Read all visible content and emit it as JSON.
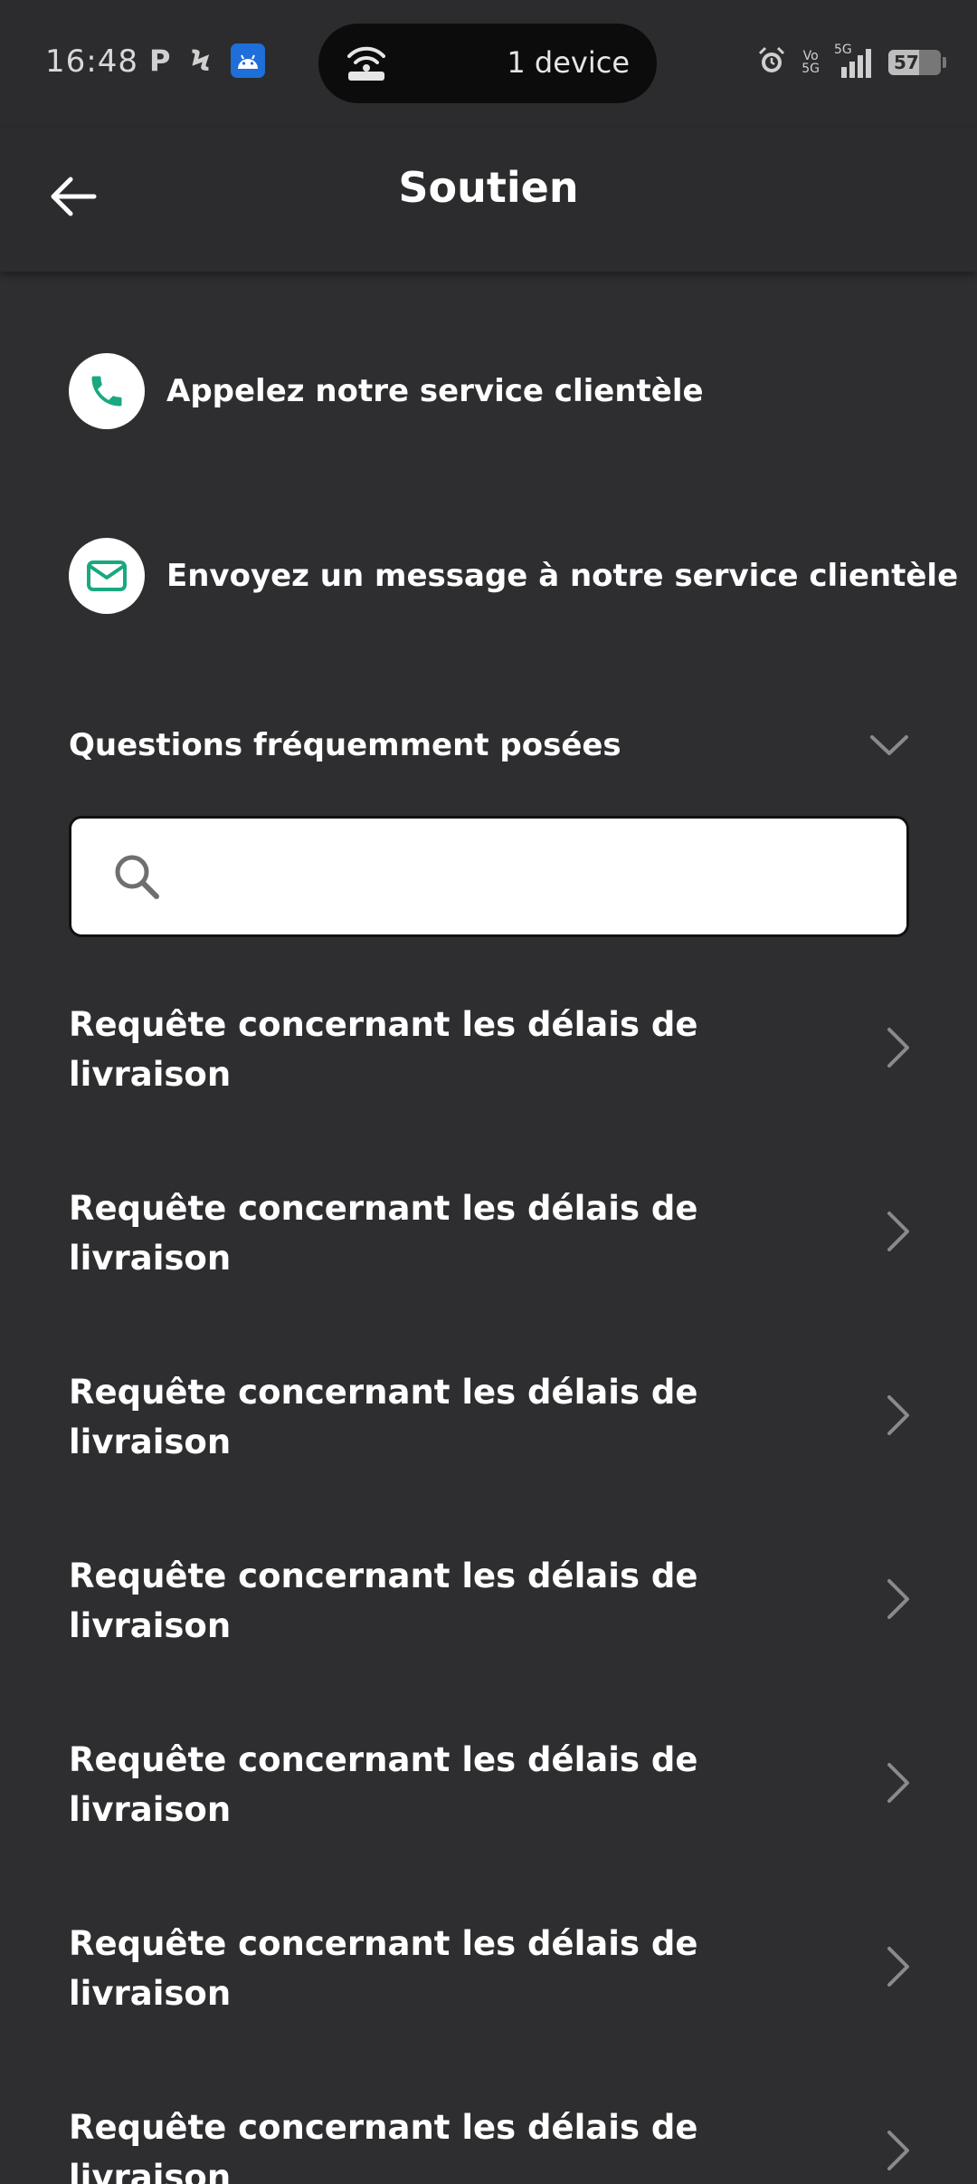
{
  "status_bar": {
    "time": "16:48",
    "left_glyphs": [
      "P",
      "Ϟ"
    ],
    "hotspot_text": "1 device",
    "signal_labels": [
      "Vo",
      "5G",
      "5G"
    ],
    "battery_level": "57"
  },
  "header": {
    "title": "Soutien"
  },
  "contact": {
    "call_label": "Appelez notre service clientèle",
    "message_label": "Envoyez un message à notre service clientèle"
  },
  "faq": {
    "title": "Questions fréquemment posées",
    "search_value": "",
    "items": [
      {
        "question": "Requête concernant les délais de livraison"
      },
      {
        "question": "Requête concernant les délais de livraison"
      },
      {
        "question": "Requête concernant les délais de livraison"
      },
      {
        "question": "Requête concernant les délais de livraison"
      },
      {
        "question": "Requête concernant les délais de livraison"
      },
      {
        "question": "Requête concernant les délais de livraison"
      },
      {
        "question": "Requête concernant les délais de livraison"
      }
    ]
  },
  "colors": {
    "background": "#2e2e30",
    "accent_green": "#1aa880",
    "text": "#ffffff",
    "chevron": "#8a8a8a"
  },
  "icons": {
    "back": "arrow-left-icon",
    "call": "phone-icon",
    "message": "mail-icon",
    "expand": "chevron-down-icon",
    "search": "search-icon",
    "row": "chevron-right-icon"
  }
}
